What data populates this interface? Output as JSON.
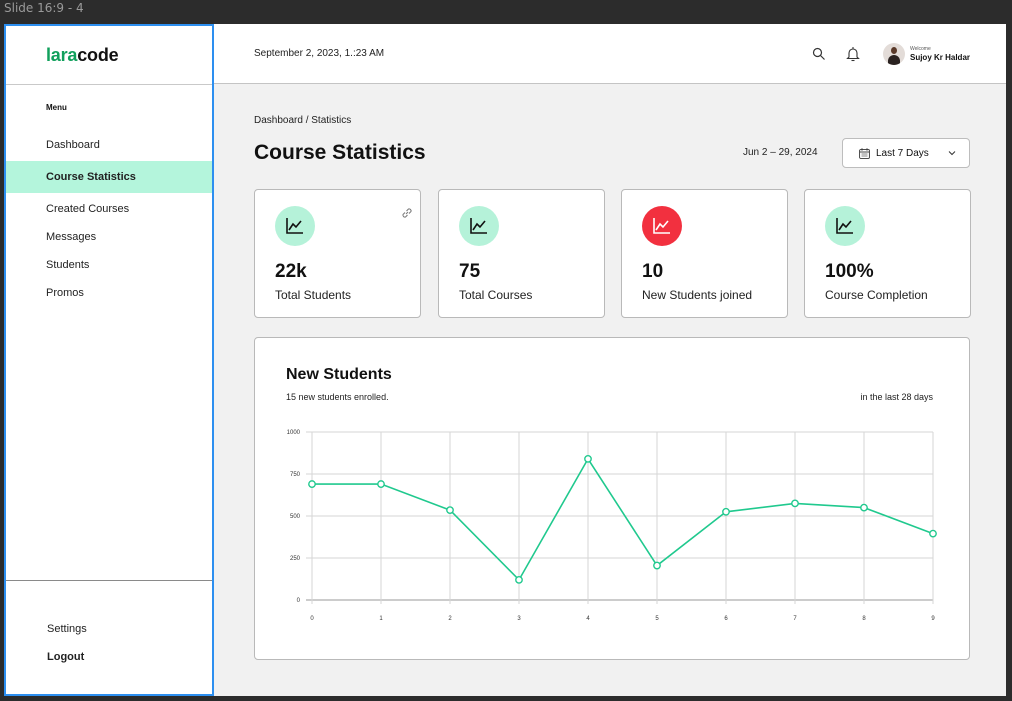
{
  "frame": {
    "label": "Slide 16:9 - 4"
  },
  "sidebar": {
    "brand": {
      "part1": "lara",
      "part2": "code"
    },
    "menu_title": "Menu",
    "items": [
      {
        "label": "Dashboard",
        "active": false
      },
      {
        "label": "Course Statistics",
        "active": true
      },
      {
        "label": "Created Courses",
        "active": false
      },
      {
        "label": "Messages",
        "active": false
      },
      {
        "label": "Students",
        "active": false
      },
      {
        "label": "Promos",
        "active": false
      }
    ],
    "bottom": {
      "settings": "Settings",
      "logout": "Logout"
    }
  },
  "header": {
    "datetime": "September 2, 2023, 1.:23 AM",
    "welcome": "Welcome",
    "username": "Sujoy Kr Haldar",
    "icons": [
      "search-icon",
      "bell-icon",
      "avatar"
    ]
  },
  "main": {
    "breadcrumb": "Dashboard / Statistics",
    "title": "Course Statistics",
    "date_range": "Jun 2 – 29, 2024",
    "range_select": {
      "label": "Last 7 Days",
      "icon": "calendar-icon"
    },
    "cards": [
      {
        "value": "22k",
        "label": "Total Students",
        "icon": "trend-icon",
        "icon_color": "#b5f2d9"
      },
      {
        "value": "75",
        "label": "Total Courses",
        "icon": "trend-icon",
        "icon_color": "#b5f2d9"
      },
      {
        "value": "10",
        "label": "New Students joined",
        "icon": "trend-icon",
        "icon_color": "#f2303f"
      },
      {
        "value": "100%",
        "label": "Course Completion",
        "icon": "trend-icon",
        "icon_color": "#b5f2d9"
      }
    ],
    "chart_card": {
      "title": "New Students",
      "subtitle": "15 new students enrolled.",
      "period": "in the last 28 days"
    }
  },
  "colors": {
    "accent": "#11a05c",
    "active_bg": "#b4f5dc",
    "line": "#20c98e",
    "alert": "#f2303f",
    "selection": "#2d8ff0"
  },
  "chart_data": {
    "type": "line",
    "x": [
      0,
      1,
      2,
      3,
      4,
      5,
      6,
      7,
      8,
      9
    ],
    "values": [
      690,
      690,
      535,
      120,
      840,
      205,
      525,
      575,
      550,
      395
    ],
    "ylim": [
      0,
      1000
    ],
    "yticks": [
      0,
      250,
      500,
      750,
      1000
    ],
    "xticks": [
      0,
      1,
      2,
      3,
      4,
      5,
      6,
      7,
      8,
      9
    ],
    "grid": true,
    "xlabel": "",
    "ylabel": ""
  }
}
